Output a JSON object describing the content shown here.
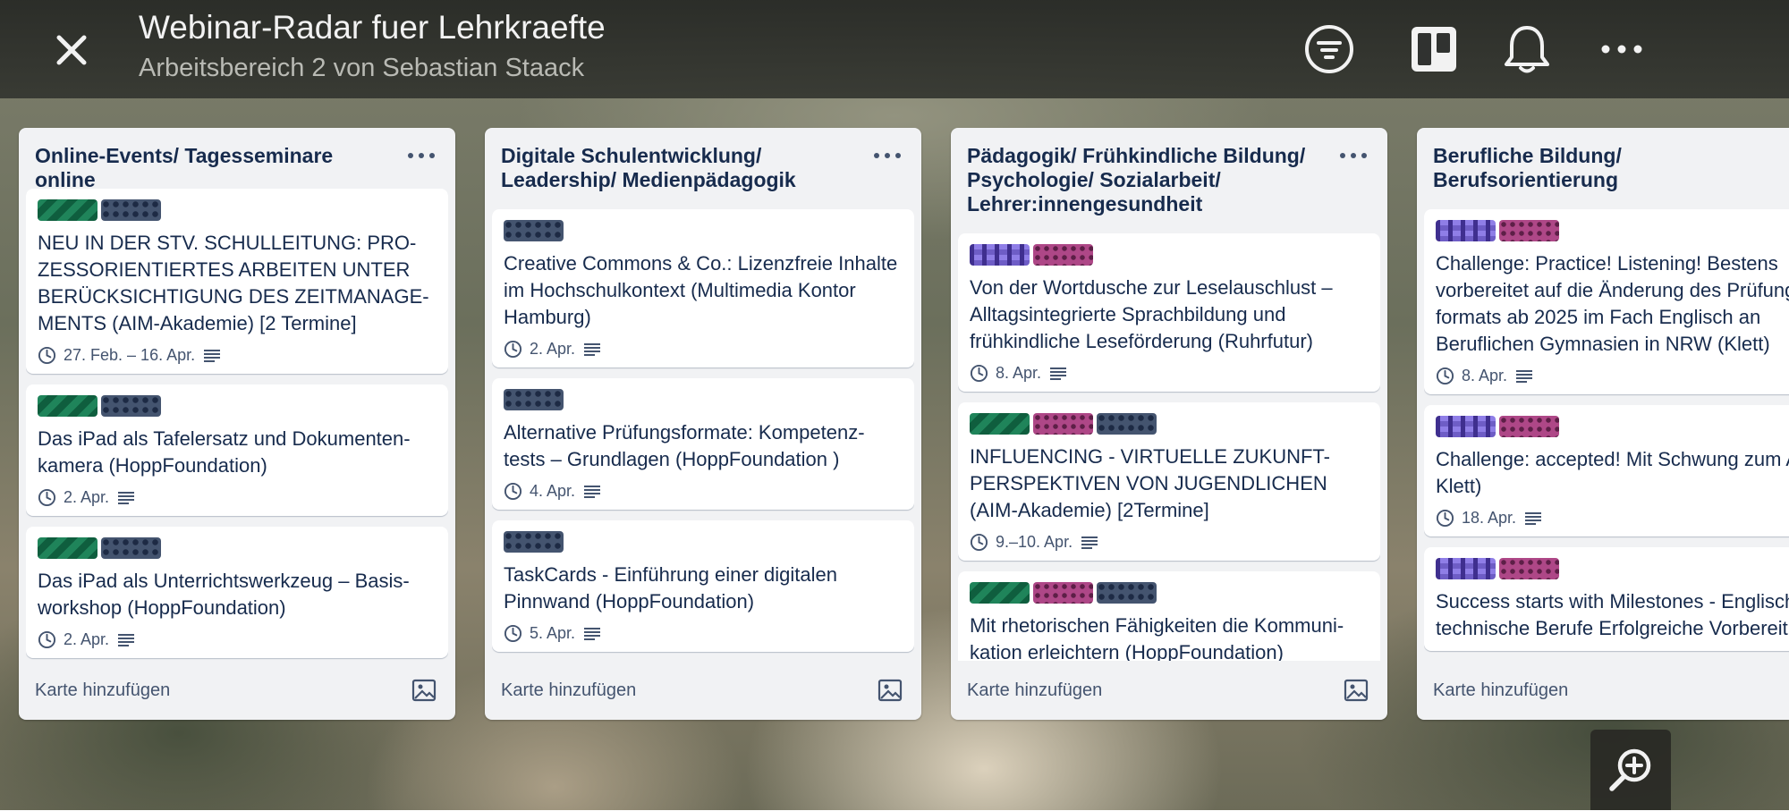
{
  "header": {
    "title": "Webinar-Radar fuer Lehrkraefte",
    "subtitle": "Arbeitsbereich 2 von Sebastian Staack"
  },
  "lists": [
    {
      "title": "Online-Events/ Tagesseminare online",
      "add_card": "Karte hinzufügen",
      "cards": [
        {
          "labels": [
            "green",
            "navy"
          ],
          "text": "NEU IN DER STV. SCHULLEITUNG: PRO-ZESSORIENTIERTES ARBEITEN UNTER BERÜCKSICHTIGUNG DES ZEITMANAGE-MENTS (AIM-Akademie) [2 Termine]",
          "date": "27. Feb. – 16. Apr."
        },
        {
          "labels": [
            "green",
            "navy"
          ],
          "text": "Das iPad als Tafelersatz und Dokumenten-kamera (HoppFoundation)",
          "date": "2. Apr."
        },
        {
          "labels": [
            "green",
            "navy"
          ],
          "text": "Das iPad als Unterrichtswerkzeug – Basis-workshop (HoppFoundation)",
          "date": "2. Apr."
        }
      ]
    },
    {
      "title": "Digitale Schulentwicklung/ Leadership/ Medienpädagogik",
      "add_card": "Karte hinzufügen",
      "cards": [
        {
          "labels": [
            "navy"
          ],
          "text": "Creative Commons & Co.: Lizenzfreie Inhalte im Hochschulkontext (Multimedia Kontor Hamburg)",
          "date": "2. Apr."
        },
        {
          "labels": [
            "navy"
          ],
          "text": "Alternative Prüfungsformate: Kompetenz-tests – Grundlagen (HoppFoundation )",
          "date": "4. Apr."
        },
        {
          "labels": [
            "navy"
          ],
          "text": "TaskCards - Einführung einer digitalen Pinnwand (HoppFoundation)",
          "date": "5. Apr."
        }
      ]
    },
    {
      "title": "Pädagogik/ Frühkindliche Bildung/ Psychologie/ Sozialarbeit/ Lehrer:innengesundheit",
      "add_card": "Karte hinzufügen",
      "cards": [
        {
          "labels": [
            "purple",
            "pink"
          ],
          "text": "Von der Wortdusche zur Leselauschlust – Alltagsintegrierte Sprachbildung und frühkindliche Leseförderung (Ruhrfutur)",
          "date": "8. Apr."
        },
        {
          "labels": [
            "green",
            "pink",
            "navy"
          ],
          "text": "INFLUENCING - VIRTUELLE ZUKUNFT-PERSPEKTIVEN VON JUGENDLICHEN (AIM-Akademie) [2Termine]",
          "date": "9.–10. Apr."
        },
        {
          "labels": [
            "green",
            "pink",
            "navy"
          ],
          "text": "Mit rhetorischen Fähigkeiten die Kommuni-kation erleichtern (HoppFoundation)",
          "date": ""
        }
      ]
    },
    {
      "title": "Berufliche Bildung/ Berufsorientierung",
      "add_card": "Karte hinzufügen",
      "cards": [
        {
          "labels": [
            "purple",
            "pink"
          ],
          "text": "Challenge: Practice! Listening! Bestens vorbereitet auf die Änderung des Prüfungs-formats ab 2025 im Fach Englisch an Beruflichen Gymnasien in NRW (Klett)",
          "date": "8. Apr."
        },
        {
          "labels": [
            "purple",
            "pink"
          ],
          "text": "Challenge: accepted! Mit Schwung zum Abitur Klett)",
          "date": "18. Apr."
        },
        {
          "labels": [
            "purple",
            "pink"
          ],
          "text": "Success starts with Milestones - Englisch für technische Berufe Erfolgreiche Vorbereitung",
          "date": ""
        }
      ]
    }
  ],
  "icons": {
    "close": "close-icon",
    "filter": "filter-icon",
    "board_view": "board-icon",
    "notifications": "bell-icon",
    "more": "more-icon",
    "list_menu": "ellipsis-icon",
    "image": "image-icon",
    "clock": "clock-icon",
    "description": "description-icon",
    "zoom": "zoom-in-icon"
  },
  "colors": {
    "list_bg": "#f1f2f4",
    "card_text": "#172b4d",
    "meta_text": "#44546f",
    "label_green": "#1f845a",
    "label_navy": "#44546f",
    "label_purple": "#6e5dc6",
    "label_pink": "#ae4787"
  }
}
